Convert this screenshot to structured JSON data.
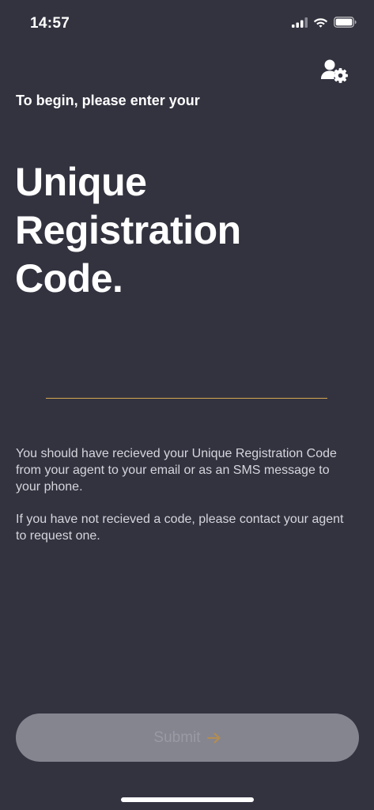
{
  "status_bar": {
    "time": "14:57"
  },
  "intro_text": "To begin, please enter your",
  "headline": {
    "line1": "Unique",
    "line2": "Registration",
    "line3": "Code."
  },
  "code_input": {
    "value": "",
    "placeholder": ""
  },
  "info": {
    "paragraph1": "You should have recieved your Unique Registration Code from your agent to your email or as an SMS message to your phone.",
    "paragraph2": "If you have not recieved a code, please contact your agent to request one."
  },
  "submit_button": {
    "label": "Submit"
  },
  "colors": {
    "background": "#333340",
    "accent": "#d4a74f",
    "button_disabled": "#858590"
  },
  "icons": {
    "profile": "user-settings-icon",
    "submit_arrow": "arrow-right-icon"
  }
}
